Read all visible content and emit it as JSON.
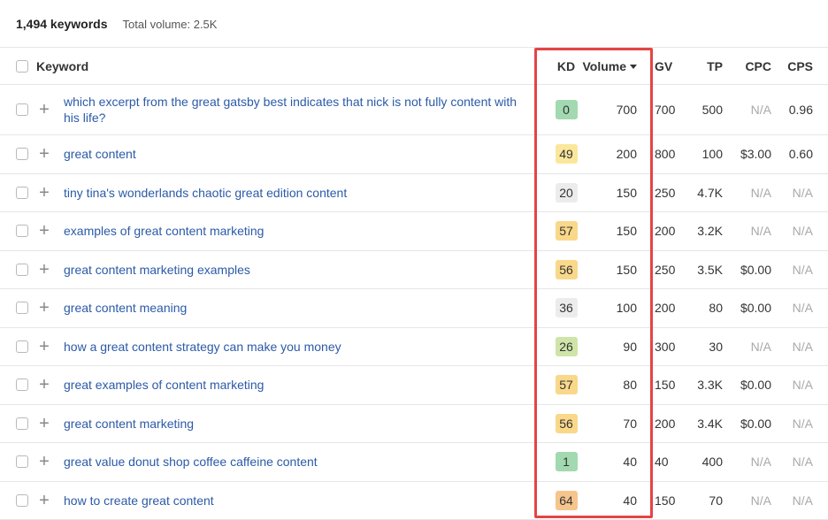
{
  "summary": {
    "keywords": "1,494 keywords",
    "total_volume": "Total volume: 2.5K"
  },
  "columns": {
    "keyword": "Keyword",
    "kd": "KD",
    "volume": "Volume",
    "gv": "GV",
    "tp": "TP",
    "cpc": "CPC",
    "cps": "CPS"
  },
  "colors": {
    "link": "#2b5aa8",
    "highlight_border": "#e44444",
    "kd_green": "#9ad3a7",
    "kd_yellow": "#f7e08a",
    "kd_orange": "#f3c987",
    "kd_lightgray": "#ececec",
    "kd_lightgreen": "#c6e0a2"
  },
  "rows": [
    {
      "keyword": "which excerpt from the great gatsby best indicates that nick is not fully content with his life?",
      "kd": "0",
      "kd_color": "#a2d9b1",
      "volume": "700",
      "gv": "700",
      "tp": "500",
      "cpc": "N/A",
      "cps": "0.96"
    },
    {
      "keyword": "great content",
      "kd": "49",
      "kd_color": "#fbe79b",
      "volume": "200",
      "gv": "800",
      "tp": "100",
      "cpc": "$3.00",
      "cps": "0.60"
    },
    {
      "keyword": "tiny tina's wonderlands chaotic great edition content",
      "kd": "20",
      "kd_color": "#ececec",
      "volume": "150",
      "gv": "250",
      "tp": "4.7K",
      "cpc": "N/A",
      "cps": "N/A"
    },
    {
      "keyword": "examples of great content marketing",
      "kd": "57",
      "kd_color": "#f9d88a",
      "volume": "150",
      "gv": "200",
      "tp": "3.2K",
      "cpc": "N/A",
      "cps": "N/A"
    },
    {
      "keyword": "great content marketing examples",
      "kd": "56",
      "kd_color": "#f9d88a",
      "volume": "150",
      "gv": "250",
      "tp": "3.5K",
      "cpc": "$0.00",
      "cps": "N/A"
    },
    {
      "keyword": "great content meaning",
      "kd": "36",
      "kd_color": "#ececec",
      "volume": "100",
      "gv": "200",
      "tp": "80",
      "cpc": "$0.00",
      "cps": "N/A"
    },
    {
      "keyword": "how a great content strategy can make you money",
      "kd": "26",
      "kd_color": "#cfe4a8",
      "volume": "90",
      "gv": "300",
      "tp": "30",
      "cpc": "N/A",
      "cps": "N/A"
    },
    {
      "keyword": "great examples of content marketing",
      "kd": "57",
      "kd_color": "#f9d88a",
      "volume": "80",
      "gv": "150",
      "tp": "3.3K",
      "cpc": "$0.00",
      "cps": "N/A"
    },
    {
      "keyword": "great content marketing",
      "kd": "56",
      "kd_color": "#f9d88a",
      "volume": "70",
      "gv": "200",
      "tp": "3.4K",
      "cpc": "$0.00",
      "cps": "N/A"
    },
    {
      "keyword": "great value donut shop coffee caffeine content",
      "kd": "1",
      "kd_color": "#a2d9b1",
      "volume": "40",
      "gv": "40",
      "tp": "400",
      "cpc": "N/A",
      "cps": "N/A"
    },
    {
      "keyword": "how to create great content",
      "kd": "64",
      "kd_color": "#f5c58c",
      "volume": "40",
      "gv": "150",
      "tp": "70",
      "cpc": "N/A",
      "cps": "N/A"
    }
  ]
}
